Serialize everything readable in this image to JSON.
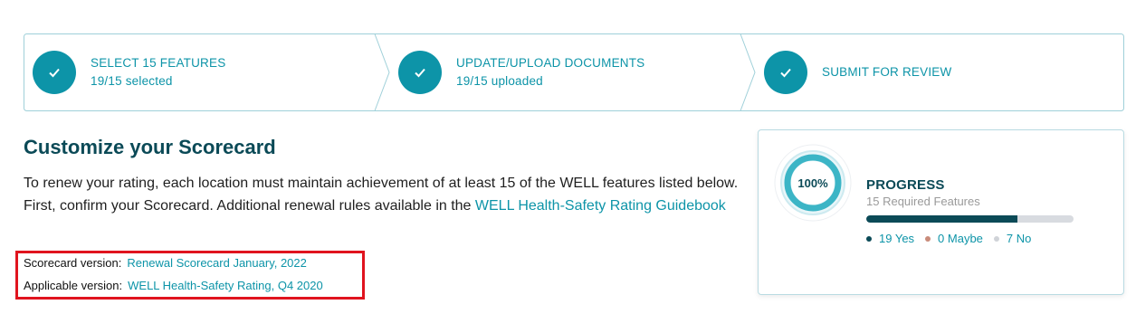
{
  "stepper": {
    "steps": [
      {
        "title": "SELECT 15 FEATURES",
        "subtitle": "19/15 selected"
      },
      {
        "title": "UPDATE/UPLOAD DOCUMENTS",
        "subtitle": "19/15 uploaded"
      },
      {
        "title": "SUBMIT FOR REVIEW",
        "subtitle": ""
      }
    ]
  },
  "main": {
    "title": "Customize your Scorecard",
    "intro_text": "To renew your rating, each location must maintain achievement of at least 15 of the WELL features listed below. First, confirm your Scorecard. Additional renewal rules available in the ",
    "guidebook_link": "WELL Health-Safety Rating Guidebook",
    "scorecard_version_label": "Scorecard version:",
    "scorecard_version_value": "Renewal Scorecard January, 2022",
    "applicable_version_label": "Applicable version:",
    "applicable_version_value": "WELL Health-Safety Rating, Q4 2020"
  },
  "progress": {
    "percent_label": "100%",
    "percent": 100,
    "title": "PROGRESS",
    "subtitle": "15 Required Features",
    "bar_fraction": 0.73,
    "legend": [
      {
        "label": "19 Yes",
        "color": "#0b4a57"
      },
      {
        "label": "0 Maybe",
        "color": "#c98b7a"
      },
      {
        "label": "7 No",
        "color": "#d0d3d8"
      }
    ]
  },
  "colors": {
    "accent": "#0d94a8",
    "dark_teal": "#0b4a57",
    "highlight_border": "#e0141e"
  }
}
